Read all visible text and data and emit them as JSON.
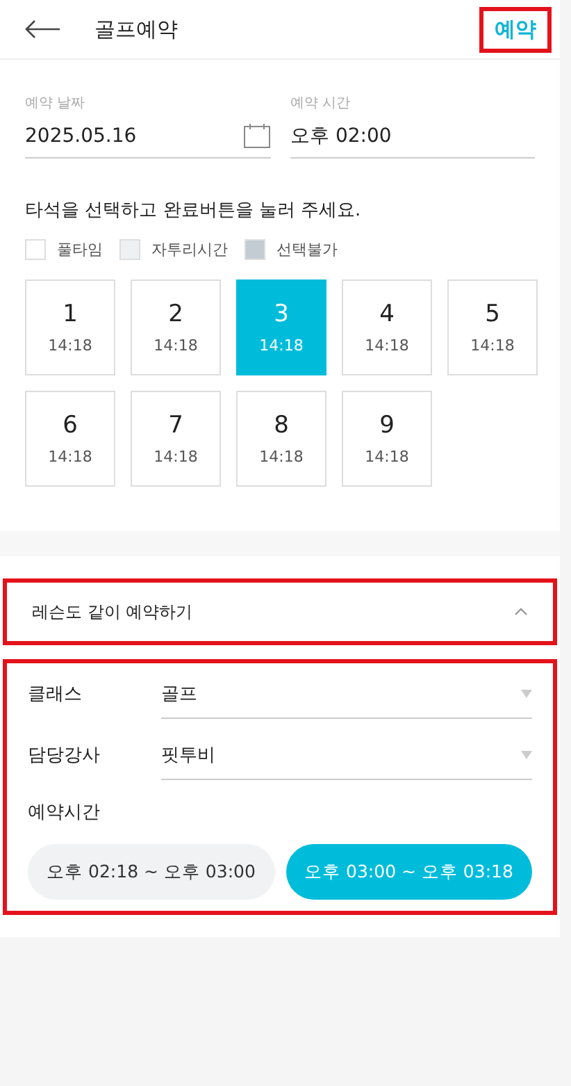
{
  "header": {
    "title": "골프예약",
    "action": {
      "label": "예약",
      "highlighted": true
    }
  },
  "date_field": {
    "label": "예약 날짜",
    "value": "2025.05.16"
  },
  "time_field": {
    "label": "예약 시간",
    "value": "오후 02:00"
  },
  "instruction": "타석을 선택하고 완료버튼을 눌러 주세요.",
  "legend": [
    {
      "kind": "full",
      "label": "풀타임"
    },
    {
      "kind": "partial",
      "label": "자투리시간"
    },
    {
      "kind": "unavailable",
      "label": "선택불가"
    }
  ],
  "seats": [
    {
      "number": "1",
      "time": "14:18",
      "selected": false
    },
    {
      "number": "2",
      "time": "14:18",
      "selected": false
    },
    {
      "number": "3",
      "time": "14:18",
      "selected": true
    },
    {
      "number": "4",
      "time": "14:18",
      "selected": false
    },
    {
      "number": "5",
      "time": "14:18",
      "selected": false
    },
    {
      "number": "6",
      "time": "14:18",
      "selected": false
    },
    {
      "number": "7",
      "time": "14:18",
      "selected": false
    },
    {
      "number": "8",
      "time": "14:18",
      "selected": false
    },
    {
      "number": "9",
      "time": "14:18",
      "selected": false
    }
  ],
  "lesson": {
    "title": "레슨도 같이 예약하기",
    "expanded": true,
    "highlighted": true,
    "body_highlighted": true,
    "class_field": {
      "label": "클래스",
      "value": "골프"
    },
    "instructor_field": {
      "label": "담당강사",
      "value": "핏투비"
    },
    "time_label": "예약시간",
    "time_options": [
      {
        "label": "오후 02:18 ~ 오후 03:00",
        "selected": false
      },
      {
        "label": "오후 03:00 ~ 오후 03:18",
        "selected": true
      }
    ]
  }
}
